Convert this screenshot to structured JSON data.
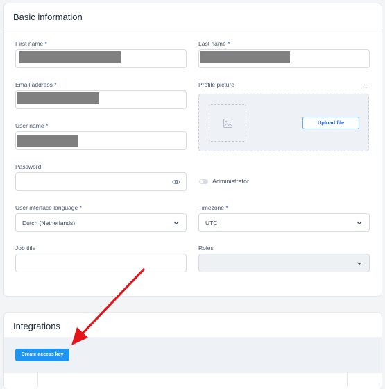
{
  "basic": {
    "title": "Basic information",
    "first_name": {
      "label": "First name",
      "required": "*"
    },
    "last_name": {
      "label": "Last name",
      "required": "*"
    },
    "email": {
      "label": "Email address",
      "required": "*"
    },
    "profile_picture": {
      "label": "Profile picture",
      "more": "...",
      "upload_label": "Upload file"
    },
    "user_name": {
      "label": "User name",
      "required": "*"
    },
    "password": {
      "label": "Password"
    },
    "administrator": {
      "label": "Administrator",
      "checked": false
    },
    "ui_language": {
      "label": "User interface language",
      "required": "*",
      "value": "Dutch (Netherlands)"
    },
    "timezone": {
      "label": "Timezone",
      "required": "*",
      "value": "UTC"
    },
    "job_title": {
      "label": "Job title"
    },
    "roles": {
      "label": "Roles"
    }
  },
  "integrations": {
    "title": "Integrations",
    "create_key_label": "Create access key"
  },
  "colors": {
    "accent": "#1e96f0",
    "annotation_arrow": "#e3151a",
    "redaction": "#808080"
  },
  "icons": [
    "eye-icon",
    "image-placeholder-icon",
    "chevron-down-icon",
    "more-options-icon",
    "annotation-arrow"
  ]
}
